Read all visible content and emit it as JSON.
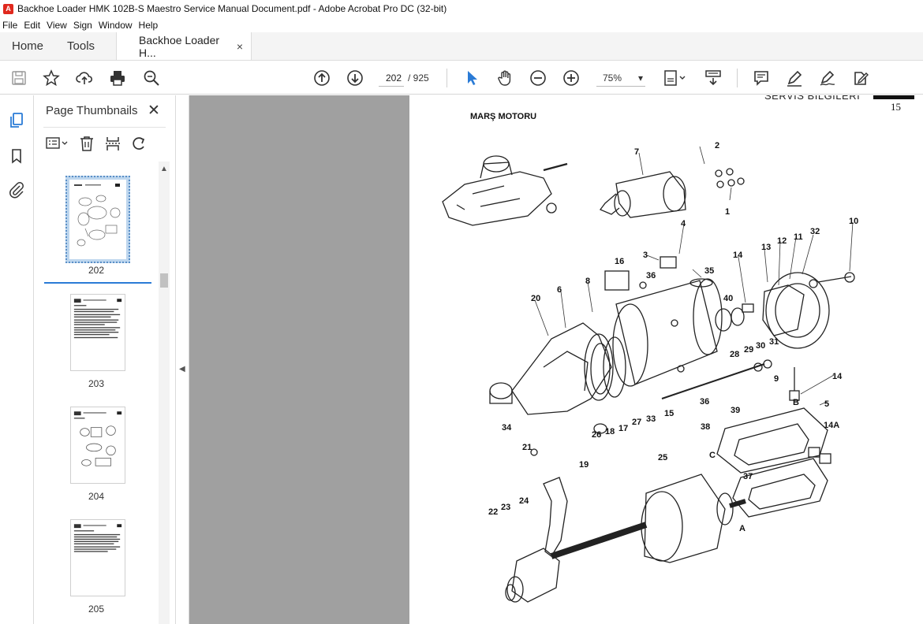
{
  "window": {
    "title": "Backhoe Loader HMK 102B-S Maestro Service Manual Document.pdf - Adobe Acrobat Pro DC (32-bit)",
    "app_icon": "acrobat-icon"
  },
  "menu": [
    "File",
    "Edit",
    "View",
    "Sign",
    "Window",
    "Help"
  ],
  "tabs": {
    "home": "Home",
    "tools": "Tools",
    "document": "Backhoe Loader H...",
    "close_glyph": "×"
  },
  "toolbar": {
    "current_page": "202",
    "total_pages": "/ 925",
    "zoom": "75%",
    "zoom_caret": "▾",
    "icons_left": [
      "save-icon",
      "bookmark-star-icon",
      "upload-cloud-icon",
      "print-icon",
      "search-zoom-icon"
    ],
    "icons_nav": [
      "page-up-icon",
      "page-down-icon"
    ],
    "icons_right": [
      "select-cursor-icon",
      "hand-pan-icon",
      "zoom-out-icon",
      "zoom-in-icon",
      "fit-page-icon",
      "read-mode-icon",
      "comment-icon",
      "highlight-pen-icon",
      "sign-icon",
      "edit-share-icon"
    ]
  },
  "left_rail": [
    "page-thumbnails-icon",
    "bookmarks-icon",
    "attachments-icon"
  ],
  "thumbnails_panel": {
    "title": "Page Thumbnails",
    "close": "✕",
    "thumbnails": [
      {
        "label": "202",
        "selected": true
      },
      {
        "label": "203",
        "selected": false
      },
      {
        "label": "204",
        "selected": false
      },
      {
        "label": "205",
        "selected": false
      }
    ]
  },
  "document_page": {
    "header_cut": "SERVIS BILGILERI",
    "page_number": "15",
    "heading": "MARŞ MOTORU",
    "callouts": [
      "2",
      "7",
      "1",
      "10",
      "4",
      "32",
      "11",
      "12",
      "3",
      "13",
      "14",
      "16",
      "35",
      "36",
      "8",
      "6",
      "20",
      "40",
      "28",
      "29",
      "30",
      "31",
      "14",
      "9",
      "36",
      "39",
      "B",
      "5",
      "15",
      "33",
      "27",
      "17",
      "18",
      "26",
      "34",
      "21",
      "14A",
      "38",
      "C",
      "25",
      "19",
      "37",
      "22",
      "23",
      "24",
      "A"
    ]
  },
  "colors": {
    "canvas_gray": "#a0a0a0",
    "selection_blue": "#2a7bd6",
    "thumb_selected_bg": "#bdd6ee",
    "acrobat_red": "#e0281d"
  }
}
